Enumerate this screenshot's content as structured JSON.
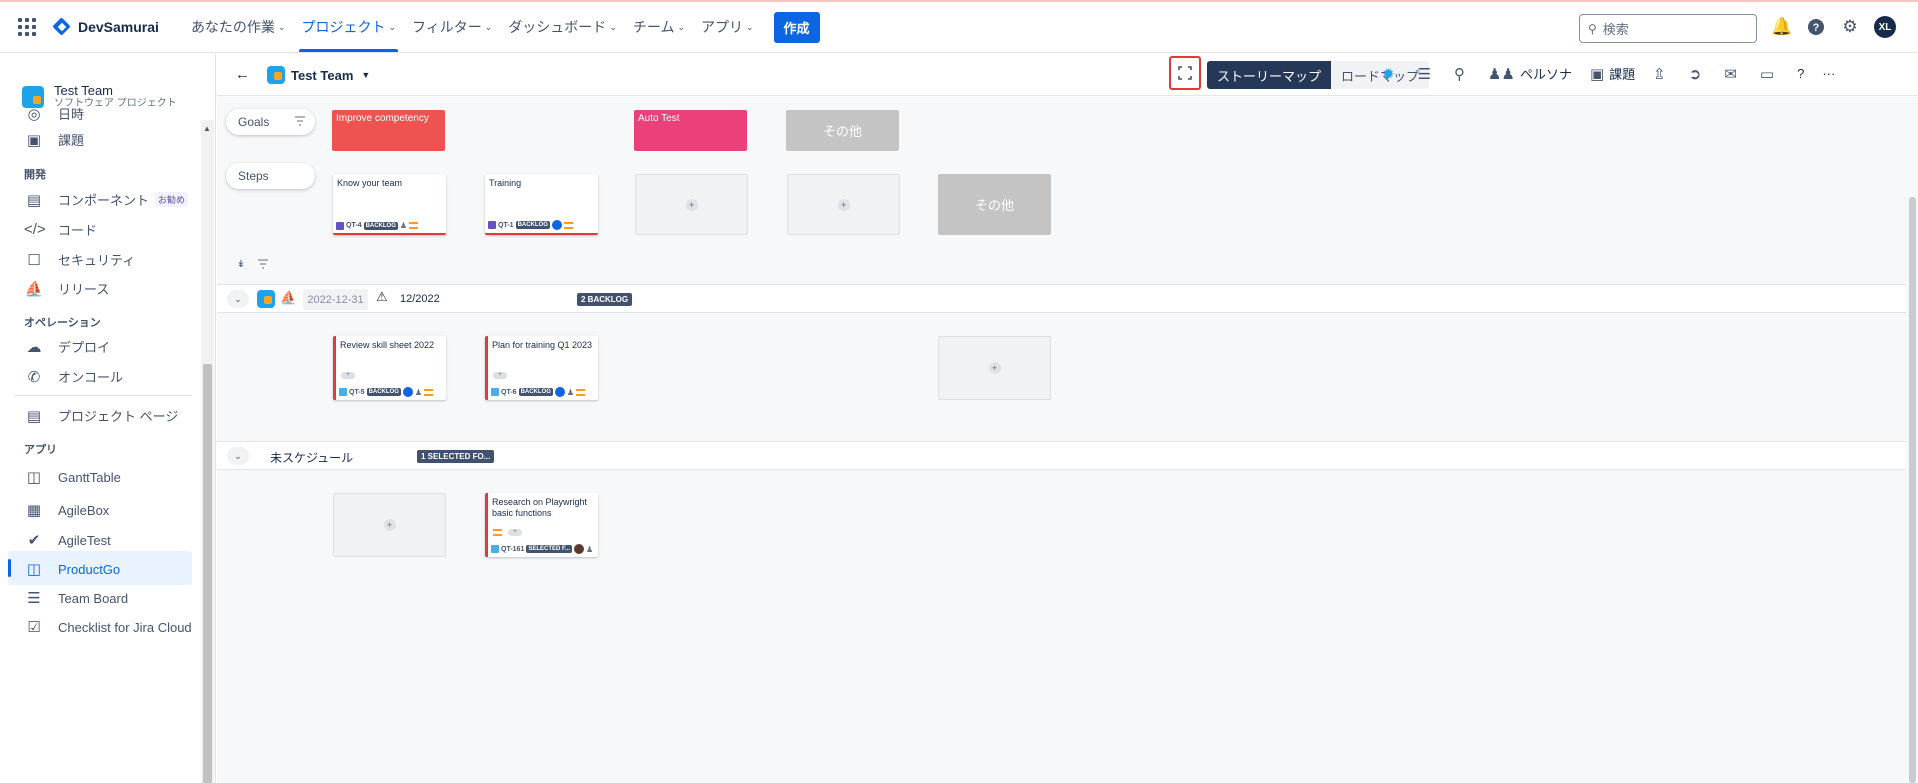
{
  "topnav": {
    "brand": "DevSamurai",
    "menu": [
      {
        "label": "あなたの作業",
        "caret": "⌄"
      },
      {
        "label": "プロジェクト",
        "caret": "⌄"
      },
      {
        "label": "フィルター",
        "caret": "⌄"
      },
      {
        "label": "ダッシュボード",
        "caret": "⌄"
      },
      {
        "label": "チーム",
        "caret": "⌄"
      },
      {
        "label": "アプリ",
        "caret": "⌄"
      }
    ],
    "create_label": "作成",
    "search_placeholder": "検索",
    "avatar_initials": "XL"
  },
  "sidebar": {
    "project_name": "Test Team",
    "project_type": "ソフトウェア プロジェクト",
    "items": {
      "timeline": "日時",
      "issues": "課題",
      "section_dev": "開発",
      "components": "コンポーネント",
      "components_badge": "お勧め",
      "code": "コード",
      "security": "セキュリティ",
      "releases": "リリース",
      "section_ops": "オペレーション",
      "deploy": "デプロイ",
      "oncall": "オンコール",
      "project_pages": "プロジェクト ページ",
      "section_apps": "アプリ",
      "gantt": "GanttTable",
      "agilebox": "AgileBox",
      "agiletest": "AgileTest",
      "productgo": "ProductGo",
      "teamboard": "Team Board",
      "checklist": "Checklist for Jira Cloud"
    }
  },
  "board": {
    "team_name": "Test Team",
    "view_story_map": "ストーリーマップ",
    "view_road_map": "ロードマップ",
    "persona_label": "ペルソナ",
    "issues_label": "課題",
    "help_label": "?",
    "more_label": "···"
  },
  "map": {
    "goals_label": "Goals",
    "steps_label": "Steps",
    "goal_1": "Improve competency",
    "goal_2": "Auto Test",
    "other_label": "その他",
    "step_card_1": {
      "title": "Know your team",
      "key": "QT-4",
      "status": "BACKLOG"
    },
    "step_card_2": {
      "title": "Training",
      "key": "QT-1",
      "status": "BACKLOG",
      "avatar": "TL"
    },
    "release_1": {
      "date": "2022-12-31",
      "name": "12/2022",
      "badge": "2 BACKLOG",
      "cards": [
        {
          "title": "Review skill sheet 2022",
          "key": "QT-5",
          "status": "BACKLOG",
          "avatar": "TL"
        },
        {
          "title": "Plan for training Q1 2023",
          "key": "QT-6",
          "status": "BACKLOG",
          "avatar": "TL"
        }
      ]
    },
    "unscheduled": {
      "label": "未スケジュール",
      "badge": "1 SELECTED FO...",
      "card": {
        "title": "Research on Playwright basic functions",
        "key": "QT-161",
        "status": "SELECTED F..."
      }
    }
  },
  "colors": {
    "accent": "#0c66e4",
    "goal_red": "#ef5350",
    "goal_pink": "#ec407a",
    "other_gray": "#c4c4c4",
    "highlight": "#e53935"
  }
}
